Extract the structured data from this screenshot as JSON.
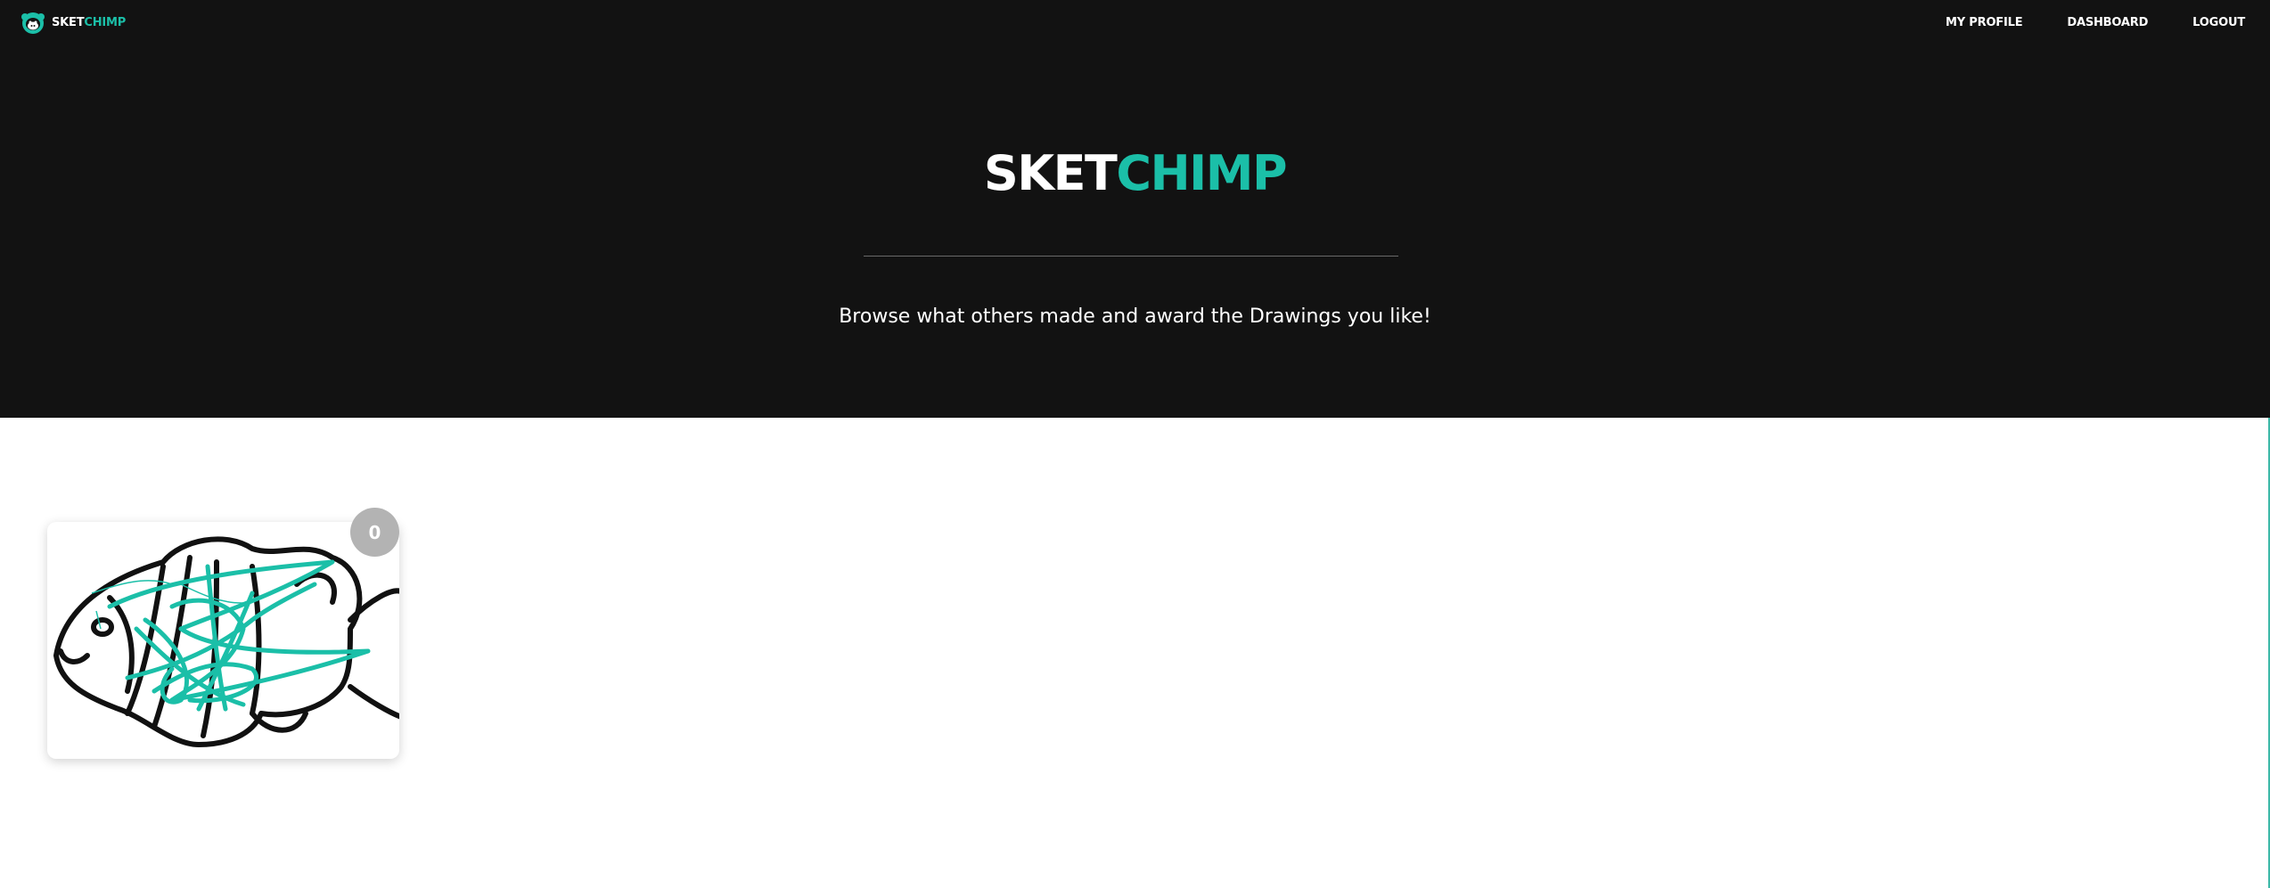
{
  "navbar": {
    "brand": {
      "part1": "SKET",
      "part2": "CHIMP"
    },
    "links": [
      "MY PROFILE",
      "DASHBOARD",
      "LOGOUT"
    ]
  },
  "hero": {
    "title_part1": "SKET",
    "title_part2": "CHIMP",
    "subtitle": "Browse what others made and award the Drawings you like!"
  },
  "gallery": {
    "drawings": [
      {
        "votes": "0"
      }
    ]
  },
  "colors": {
    "background_dark": "#121212",
    "accent": "#1bbfa8",
    "badge": "#b3b3b3"
  }
}
